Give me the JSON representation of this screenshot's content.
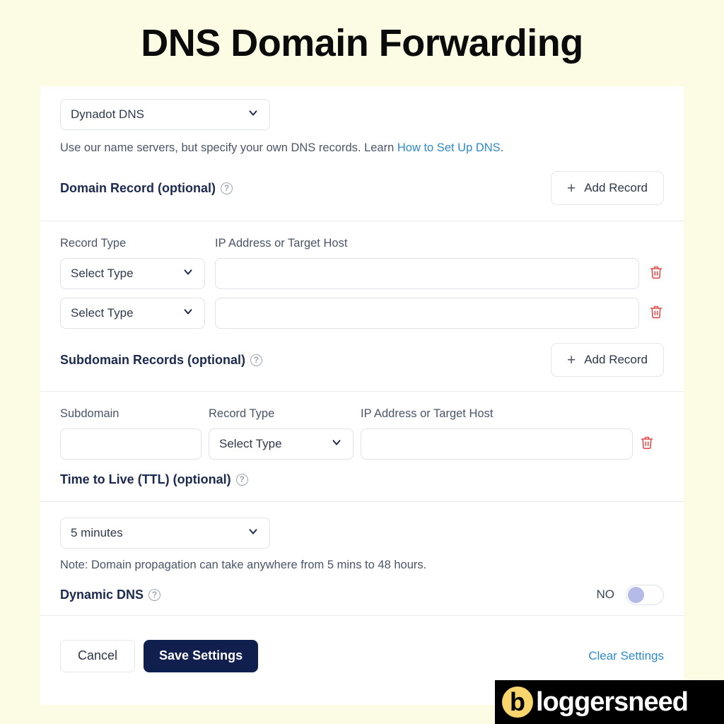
{
  "page": {
    "title": "DNS Domain Forwarding",
    "background_color": "#FCFBE3"
  },
  "dns_mode": {
    "selected": "Dynadot DNS",
    "description_before_link": "Use our name servers, but specify your own DNS records. Learn ",
    "link_text": "How to Set Up DNS",
    "description_after_link": "."
  },
  "domain_record": {
    "heading": "Domain Record (optional)",
    "help_glyph": "?",
    "add_button": "Add Record",
    "plus_glyph": "+",
    "columns": {
      "record_type": "Record Type",
      "target": "IP Address or Target Host"
    },
    "rows": [
      {
        "type": "Select Type",
        "target": ""
      },
      {
        "type": "Select Type",
        "target": ""
      }
    ]
  },
  "subdomain_records": {
    "heading": "Subdomain Records (optional)",
    "add_button": "Add Record",
    "columns": {
      "subdomain": "Subdomain",
      "record_type": "Record Type",
      "target": "IP Address or Target Host"
    },
    "rows": [
      {
        "subdomain": "",
        "type": "Select Type",
        "target": ""
      }
    ]
  },
  "ttl": {
    "heading": "Time to Live (TTL) (optional)",
    "selected": "5 minutes",
    "note": "Note: Domain propagation can take anywhere from 5 mins to 48 hours."
  },
  "dynamic_dns": {
    "label": "Dynamic DNS",
    "state_label": "NO",
    "enabled": false
  },
  "footer": {
    "cancel": "Cancel",
    "save": "Save Settings",
    "clear": "Clear Settings"
  },
  "watermark": {
    "badge": "b",
    "text": "loggersneed"
  },
  "colors": {
    "accent_link": "#2e8bc9",
    "save_bg": "#101f4d",
    "trash": "#e04b4b",
    "heading": "#1b2a4e",
    "toggle_knob": "#b4bbe6"
  }
}
